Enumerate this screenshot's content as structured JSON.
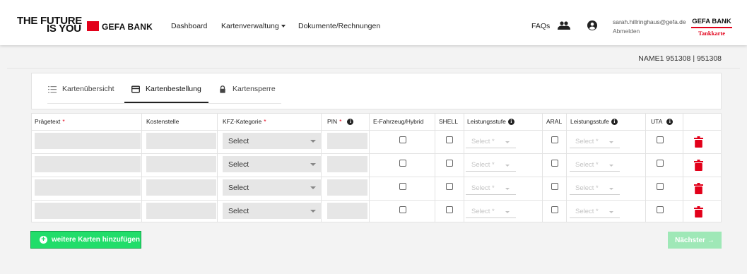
{
  "header": {
    "logo_line1": "THE FUTURE",
    "logo_line2": "IS YOU",
    "logo_bank": "GEFA BANK",
    "nav": {
      "dashboard": "Dashboard",
      "kartenverwaltung": "Kartenverwaltung",
      "dokumente": "Dokumente/Rechnungen"
    },
    "faq": "FAQs",
    "user_email": "sarah.hillringhaus@gefa.de",
    "logout": "Abmelden",
    "brand_right_top": "GEFA BANK",
    "brand_right_bottom": "Tankkarte"
  },
  "account_id": "NAME1 951308 | 951308",
  "tabs": [
    {
      "label": "Kartenübersicht",
      "icon": "list-icon",
      "active": false
    },
    {
      "label": "Kartenbestellung",
      "icon": "card-icon",
      "active": true
    },
    {
      "label": "Kartensperre",
      "icon": "lock-icon",
      "active": false
    }
  ],
  "table": {
    "headers": {
      "praegetext": "Prägetext",
      "kostenstelle": "Kostenstelle",
      "kfz": "KFZ-Kategorie",
      "pin": "PIN",
      "efahrzeug": "E-Fahrzeug/Hybrid",
      "shell": "SHELL",
      "leistungsstufe1": "Leistungsstufe",
      "aral": "ARAL",
      "leistungsstufe2": "Leistungsstufe",
      "uta": "UTA"
    },
    "required_mark": "*",
    "info_mark": "i",
    "rows": [
      {
        "kfz": "Select",
        "shell_level": "Select *",
        "aral_level": "Select *"
      },
      {
        "kfz": "Select",
        "shell_level": "Select *",
        "aral_level": "Select *"
      },
      {
        "kfz": "Select",
        "shell_level": "Select *",
        "aral_level": "Select *"
      },
      {
        "kfz": "Select",
        "shell_level": "Select *",
        "aral_level": "Select *"
      }
    ]
  },
  "buttons": {
    "add_cards": "weitere Karten hinzufügen",
    "next": "Nächster",
    "next_arrow": "→",
    "plus": "+"
  },
  "colors": {
    "brand_red": "#e2001a",
    "add_green": "#21dd6a",
    "next_disabled": "#9fe8b7",
    "input_gray": "#e6e6e6"
  }
}
